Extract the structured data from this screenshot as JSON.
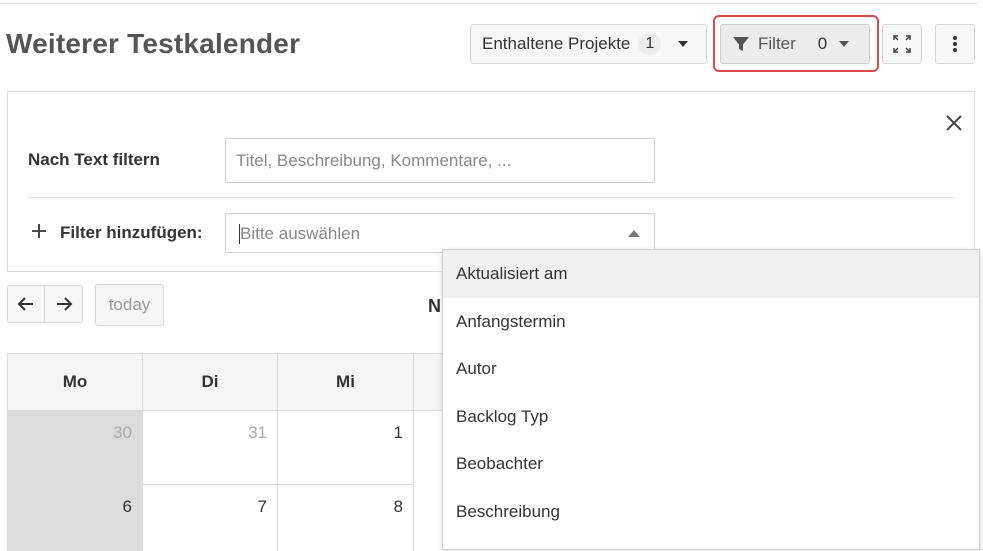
{
  "title": "Weiterer Testkalender",
  "header": {
    "projects_label": "Enthaltene Projekte",
    "projects_count": "1",
    "filter_label": "Filter",
    "filter_count": "0"
  },
  "filter_panel": {
    "text_filter_label": "Nach Text filtern",
    "text_filter_placeholder": "Titel, Beschreibung, Kommentare, ...",
    "add_filter_label": "Filter hinzufügen:",
    "select_placeholder": "Bitte auswählen",
    "options": [
      "Aktualisiert am",
      "Anfangstermin",
      "Autor",
      "Backlog Typ",
      "Beobachter",
      "Beschreibung"
    ]
  },
  "navigation": {
    "today_label": "today",
    "month_partial": "N"
  },
  "calendar": {
    "weekdays": [
      "Mo",
      "Di",
      "Mi"
    ],
    "week1": [
      "30",
      "31",
      "1"
    ],
    "week2": [
      "6",
      "7",
      "8"
    ]
  },
  "colors": {
    "highlight": "#dc4b4b",
    "shaded_cell": "#dcdcdc"
  }
}
